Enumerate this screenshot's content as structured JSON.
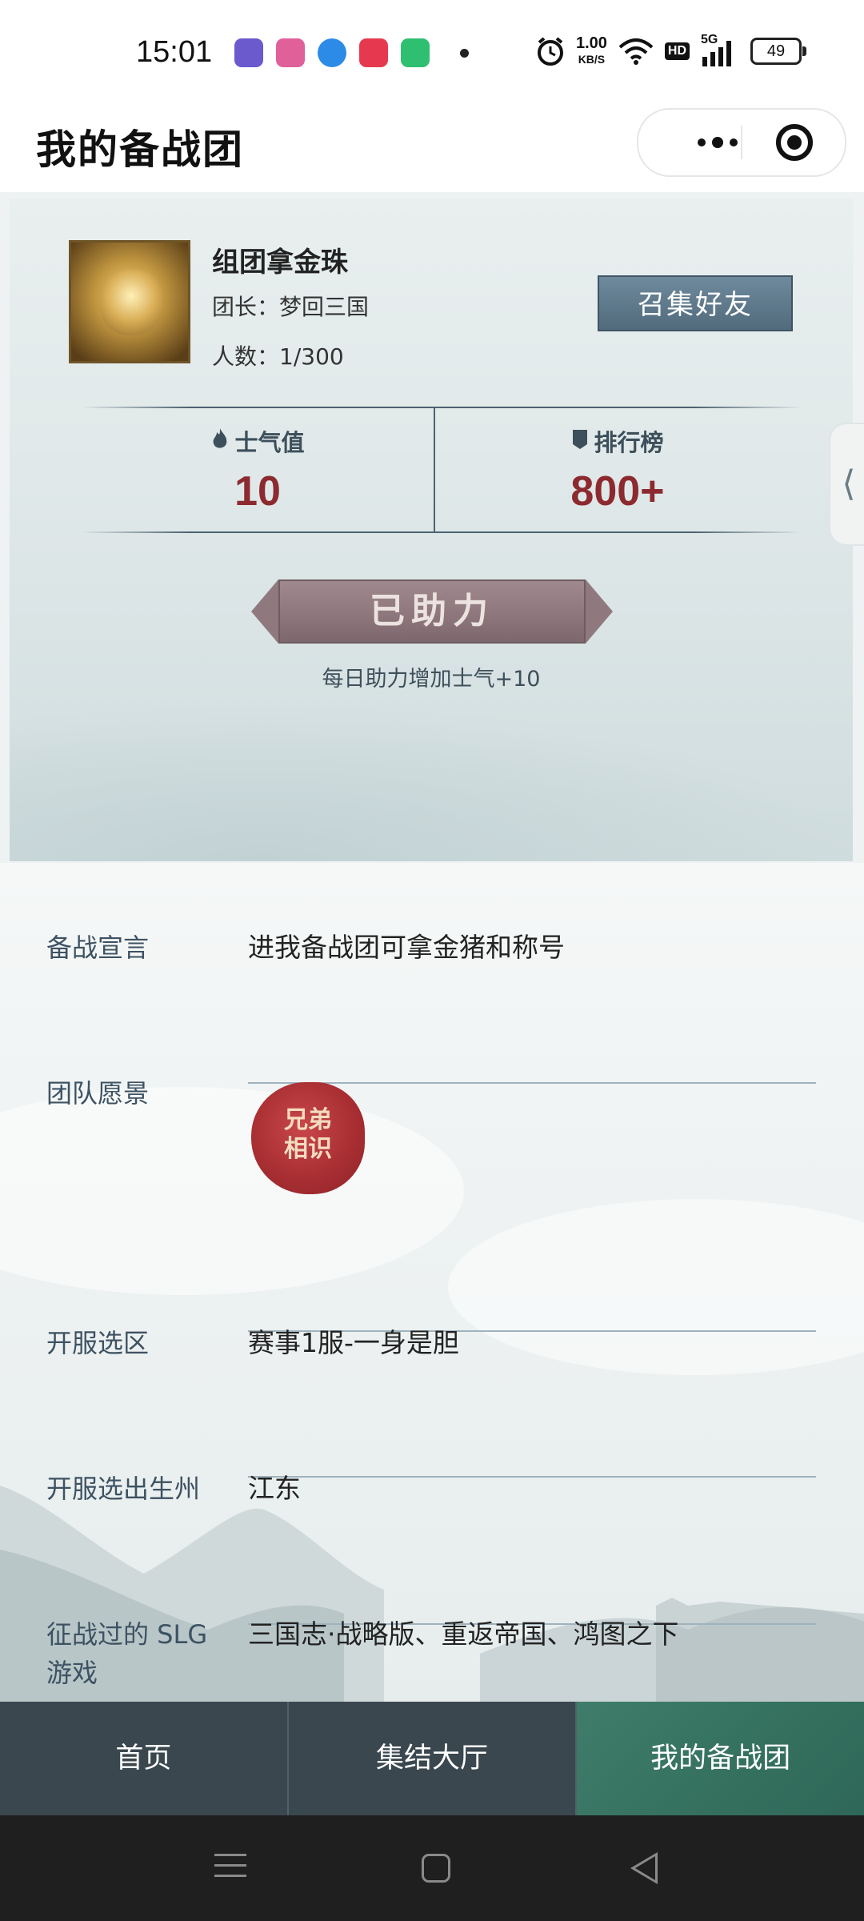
{
  "status_bar": {
    "time": "15:01",
    "net_speed_value": "1.00",
    "net_speed_unit": "KB/S",
    "hd": "HD",
    "network": "5G",
    "battery": "49",
    "app_colors": [
      "#6a5acd",
      "#e0609a",
      "#2c8be6",
      "#e63950",
      "#2fbf71"
    ]
  },
  "title_bar": {
    "title": "我的备战团"
  },
  "team": {
    "name": "组团拿金珠",
    "leader": "团长：梦回三国",
    "members": "人数：1/300",
    "invite_button": "召集好友",
    "morale_label": "士气值",
    "morale_value": "10",
    "rank_label": "排行榜",
    "rank_value": "800+",
    "helped_button": "已助力",
    "helped_tip": "每日助力增加士气+10",
    "side_tab_icon": "⟨"
  },
  "form": {
    "declaration_label": "备战宣言",
    "declaration_value": "进我备战团可拿金猪和称号",
    "vision_label": "团队愿景",
    "vision_seal_line1": "兄弟",
    "vision_seal_line2": "相识",
    "server_label": "开服选区",
    "server_value": "赛事1服-一身是胆",
    "state_label": "开服选出生州",
    "state_value": "江东",
    "games_label_line1": "征战过的 SLG",
    "games_label_line2": "游戏",
    "games_value": "三国志·战略版、重返帝国、鸿图之下"
  },
  "tabbar": {
    "home": "首页",
    "hall": "集结大厅",
    "mine": "我的备战团",
    "active": "mine"
  },
  "colors": {
    "accent_red": "#8c2a2f",
    "tab_active": "#2e6757",
    "tab_bg": "#3a474f"
  }
}
